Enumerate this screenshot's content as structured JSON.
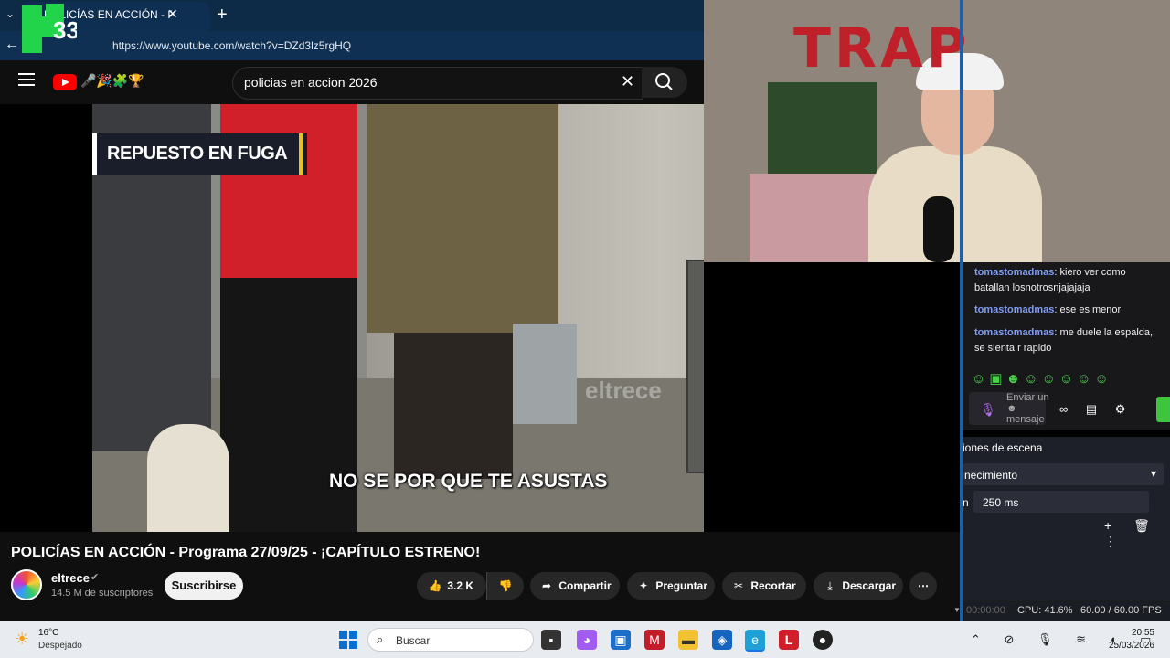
{
  "browser": {
    "tab_title": "POLICÍAS EN ACCIÓN - Progra",
    "tab_close": "✕",
    "new_tab": "+",
    "url": "https://www.youtube.com/watch?v=DZd3lz5rgHQ",
    "back": "←",
    "dropdown": "⌄"
  },
  "youtube": {
    "search_value": "policias en accion 2026",
    "clear_icon": "✕",
    "search_icon": "⌕",
    "doodle": "🎤🎉🧩🏆"
  },
  "video": {
    "banner": "REPUESTO EN FUGA",
    "subtitle": "NO SE POR QUE TE ASUSTAS",
    "watermark": "eltrece",
    "title": "POLICÍAS EN ACCIÓN - Programa 27/09/25 - ¡CAPÍTULO ESTRENO!",
    "channel_name": "eltrece",
    "verified": "✔",
    "subscribers": "14.5 M de suscriptores",
    "subscribe_label": "Suscribirse",
    "likes": "3.2 K",
    "like_icon": "👍",
    "dislike_icon": "👎",
    "share_icon": "➦",
    "ask_icon": "✦",
    "clip_icon": "✂",
    "download_icon": "⤓",
    "share_label": "Compartir",
    "ask_label": "Preguntar",
    "clip_label": "Recortar",
    "download_label": "Descargar",
    "more_icon": "⋯",
    "scroll_icon": "▼"
  },
  "stream": {
    "wall_text": "TRAP"
  },
  "chat": {
    "messages": [
      {
        "user": "tomastomadmas",
        "text": ": kiero ver como batallan losnotrosnjajajaja"
      },
      {
        "user": "tomastomadmas",
        "text": ": ese es menor"
      },
      {
        "user": "tomastomadmas",
        "text": ": me duele la espalda, se sienta r rapido"
      }
    ],
    "emotes": "☺▣☻☺☺☺☺☺",
    "send_placeholder": "Enviar un ☻ mensaje",
    "mic_icon": "🎙",
    "toolbar_icons": "∞ ▤ ⚙"
  },
  "obs": {
    "panel_title": "iones de escena",
    "transition": "necimiento",
    "duration_label": "n",
    "duration": "250 ms",
    "icons": "+ 🗑 ⋮",
    "time": "00:00:00",
    "cpu": "CPU: 41.6%",
    "fps": "60.00 / 60.00 FPS",
    "dropdown_icon": "▾"
  },
  "taskbar": {
    "weather_icon": "☀",
    "temperature": "16°C",
    "condition": "Despejado",
    "search_icon": "⌕",
    "search_placeholder": "Buscar",
    "app_icons": [
      "▪",
      "◕",
      "▣",
      "M",
      "▬",
      "◈",
      "e",
      "L",
      "●"
    ],
    "tray": "⌃ ⊘ 🎙 ≋ ◖ ▭",
    "time": "20:55",
    "date": "25/03/2026"
  }
}
